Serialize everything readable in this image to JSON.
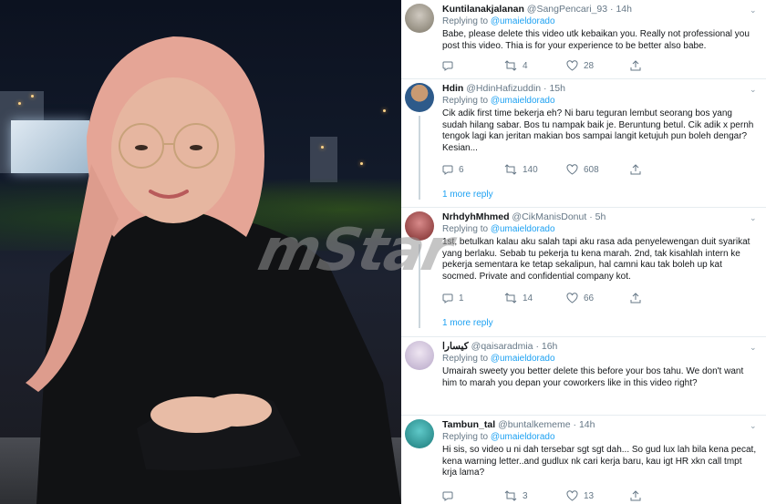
{
  "watermark": {
    "brand": "mStar"
  },
  "tweets": [
    {
      "name": "Kuntilanakjalanan",
      "handle": "@SangPencari_93",
      "time": "14h",
      "replying_prefix": "Replying to ",
      "replying_to": "@umaieldorado",
      "text": "Babe, please delete this video utk kebaikan you. Really not professional you post this video. Thia is for your experience to be better also babe.",
      "replies": "",
      "retweets": "4",
      "likes": "28",
      "more_replies": ""
    },
    {
      "name": "Hdin",
      "handle": "@HdinHafizuddin",
      "time": "15h",
      "replying_prefix": "Replying to ",
      "replying_to": "@umaieldorado",
      "text": "Cik adik first time bekerja eh? Ni baru  teguran lembut seorang bos yang sudah hilang sabar. Bos tu nampak baik je. Beruntung betul. Cik adik x pernh tengok lagi kan jeritan makian bos sampai langit ketujuh pun boleh dengar? Kesian...",
      "replies": "6",
      "retweets": "140",
      "likes": "608",
      "more_replies": "1 more reply"
    },
    {
      "name": "NrhdyhMhmed",
      "handle": "@CikManisDonut",
      "time": "5h",
      "replying_prefix": "Replying to ",
      "replying_to": "@umaieldorado",
      "text": "1st, betulkan kalau aku salah tapi aku rasa ada penyelewengan duit syarikat yang berlaku. Sebab tu pekerja tu kena marah. 2nd, tak kisahlah intern ke pekerja sementara ke tetap sekalipun, hal camni kau tak boleh up kat socmed. Private and confidential company kot.",
      "replies": "1",
      "retweets": "14",
      "likes": "66",
      "more_replies": "1 more reply"
    },
    {
      "name": "كيسارا",
      "handle": "@qaisaradmia",
      "time": "16h",
      "replying_prefix": "Replying to ",
      "replying_to": "@umaieldorado",
      "text": "Umairah sweety you better delete this before your bos tahu. We don't want him to marah you depan your coworkers like in this video right?",
      "replies": "",
      "retweets": "",
      "likes": "",
      "more_replies": ""
    },
    {
      "name": "Tambun_tal",
      "handle": "@buntalkememe",
      "time": "14h",
      "replying_prefix": "Replying to ",
      "replying_to": "@umaieldorado",
      "text": "Hi sis, so video u ni dah tersebar sgt sgt dah... So gud lux lah bila kena pecat, kena warning letter..and gudlux nk cari kerja baru, kau igt HR xkn call tmpt krja lama?",
      "replies": "",
      "retweets": "3",
      "likes": "13",
      "more_replies": ""
    }
  ],
  "icons": {
    "reply": "reply-icon",
    "retweet": "retweet-icon",
    "like": "heart-icon",
    "share": "share-icon",
    "caret": "chevron-down-icon"
  },
  "colors": {
    "link": "#1da1f2",
    "muted": "#657786",
    "text": "#14171a"
  }
}
